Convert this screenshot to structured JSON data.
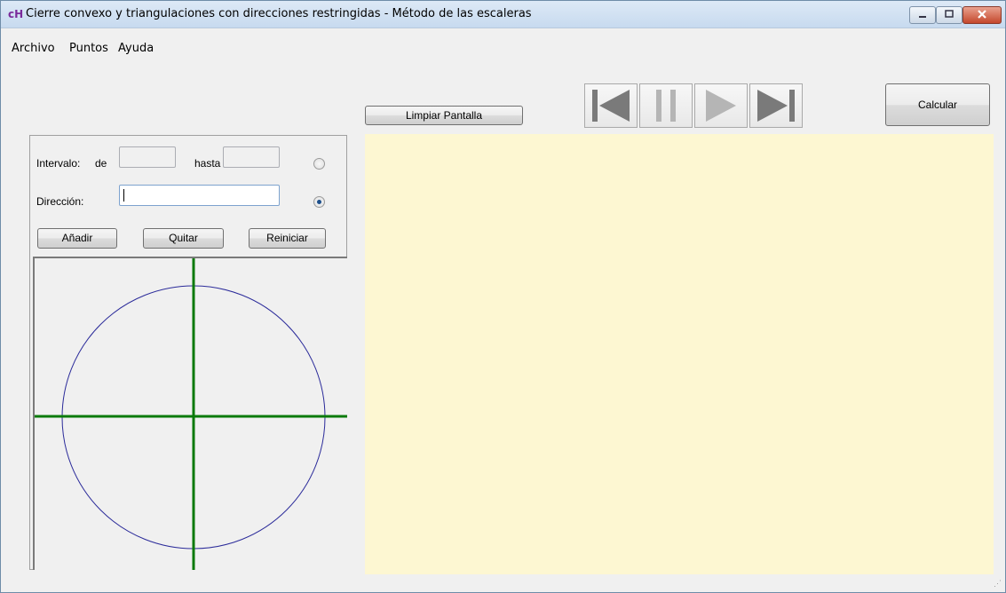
{
  "window": {
    "title": "Cierre convexo y triangulaciones con direcciones restringidas - Método de las escaleras",
    "icon": "ch-app-icon",
    "controls": [
      "minimize",
      "maximize",
      "close"
    ]
  },
  "menu": {
    "items": [
      "Archivo",
      "Puntos",
      "Ayuda"
    ]
  },
  "toolbar": {
    "clear_label": "Limpiar Pantalla",
    "calculate_label": "Calcular",
    "playback": [
      "skip-to-start-icon",
      "pause-icon",
      "play-icon",
      "skip-to-end-icon"
    ]
  },
  "direction_panel": {
    "interval_label": "Intervalo:",
    "from_label": "de",
    "from_value": "",
    "to_label": "hasta",
    "to_value": "",
    "interval_selected": false,
    "direction_label": "Dirección:",
    "direction_value": "",
    "direction_selected": true,
    "add_label": "Añadir",
    "remove_label": "Quitar",
    "reset_label": "Reiniciar"
  },
  "colors": {
    "circle": "#2b2b9a",
    "axes": "#0a7a0a",
    "canvas_bg": "#fdf7d2",
    "form_bg": "#f0f0f0"
  }
}
